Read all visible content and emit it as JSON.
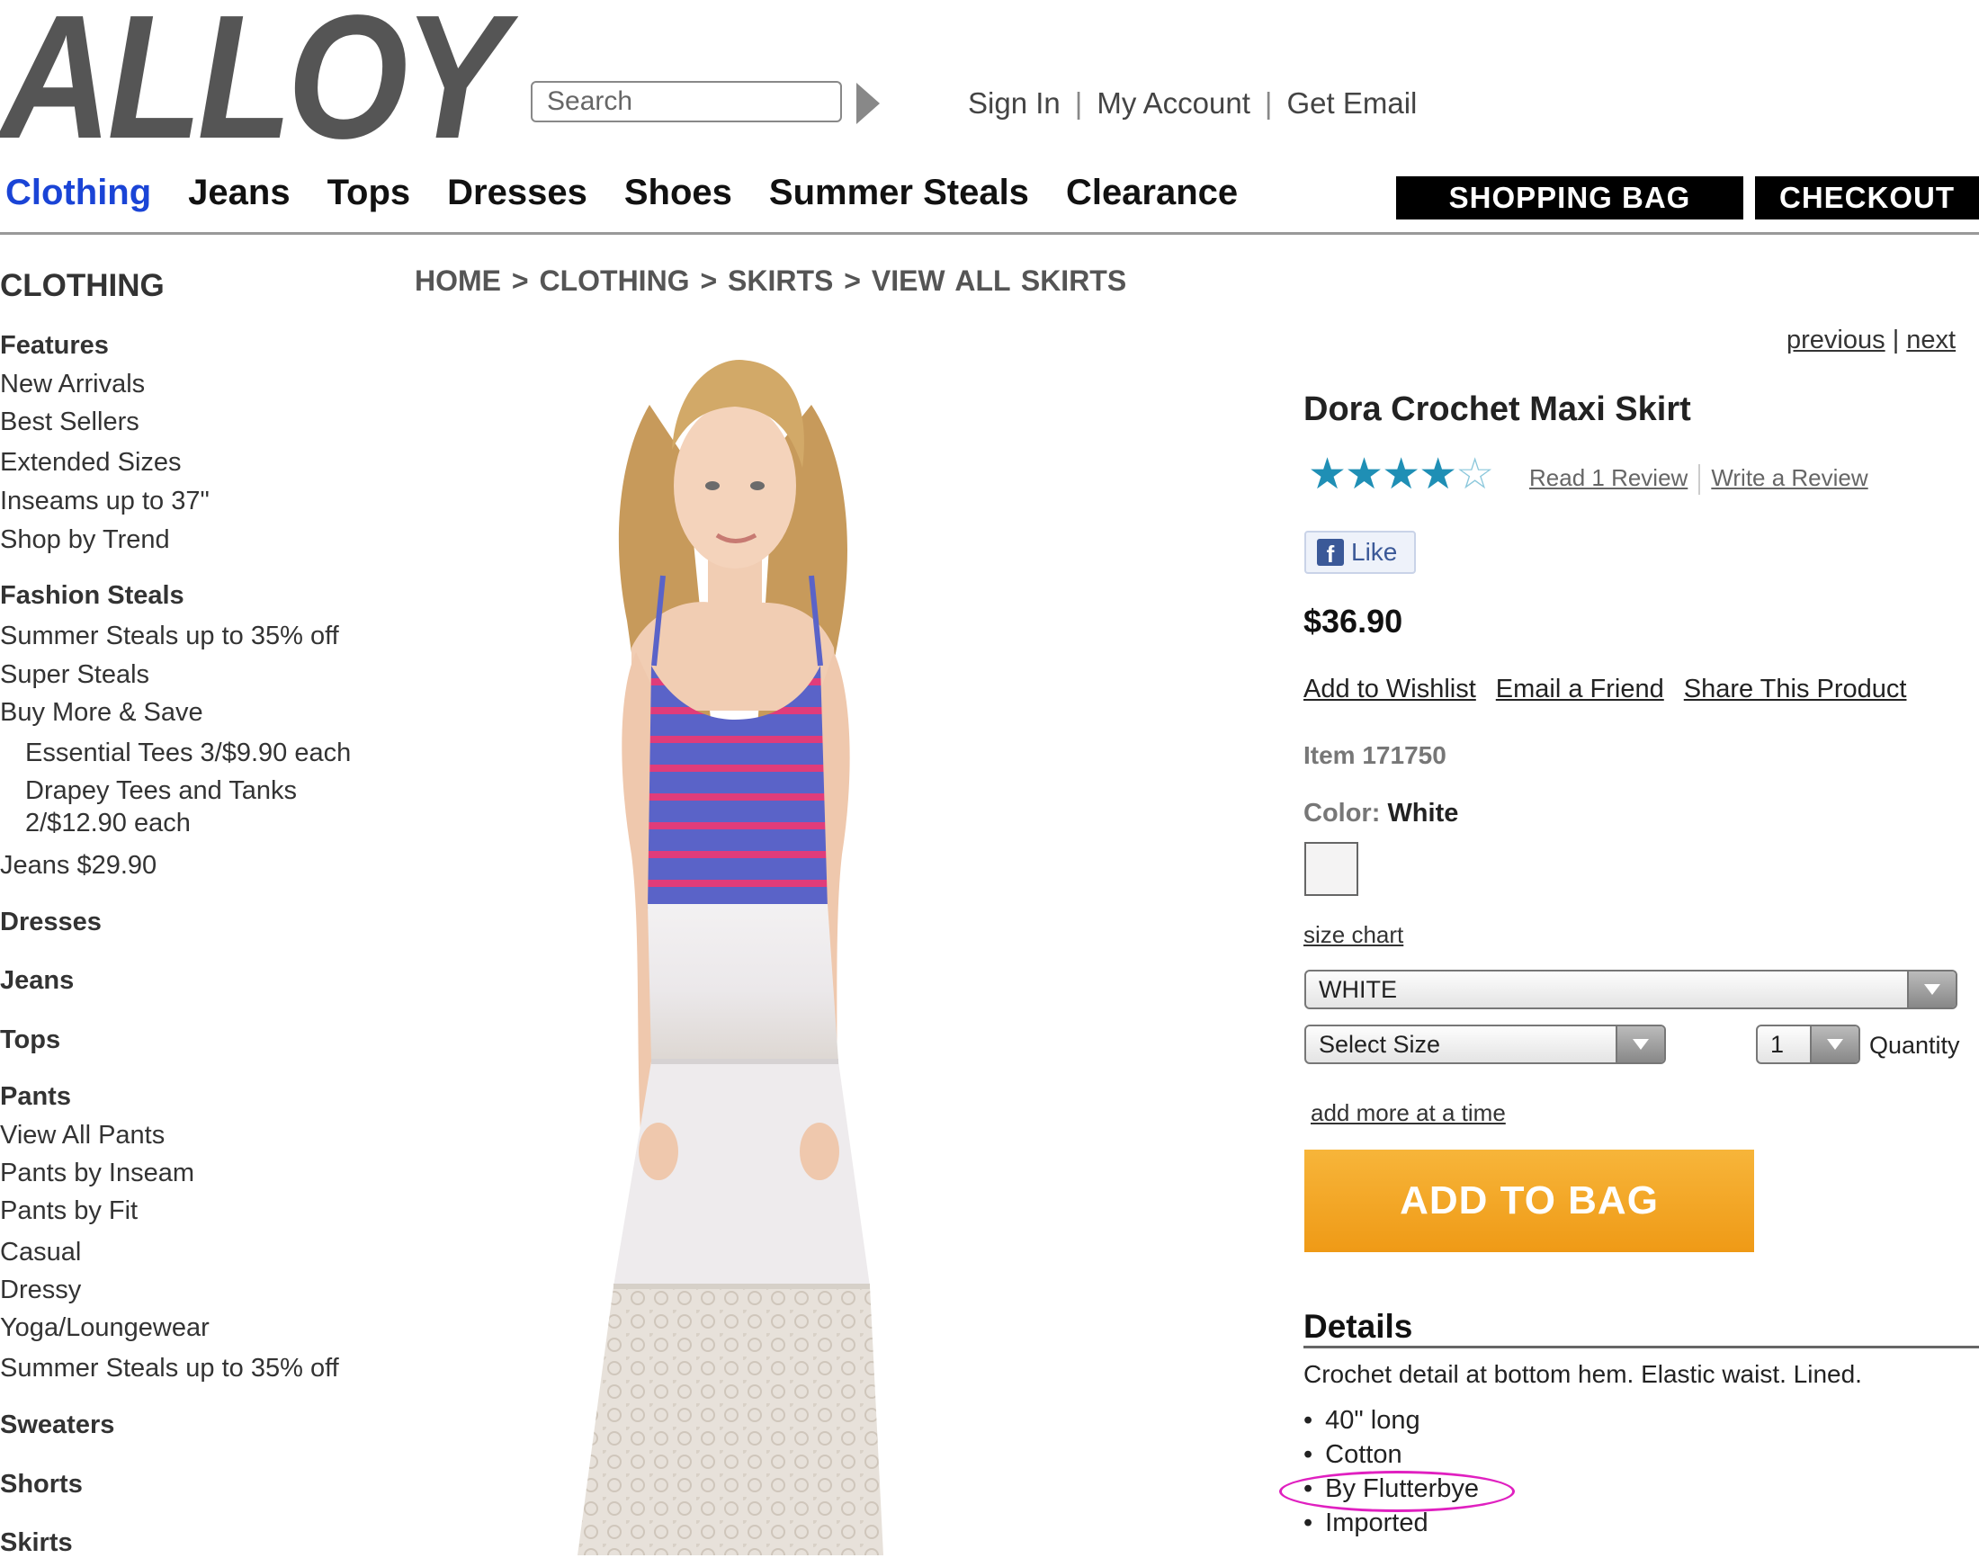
{
  "header": {
    "logo": "ALLOY",
    "search_placeholder": "Search",
    "sign_in": "Sign In",
    "my_account": "My Account",
    "get_email": "Get Email",
    "separator": "|"
  },
  "nav": {
    "items": [
      "Clothing",
      "Jeans",
      "Tops",
      "Dresses",
      "Shoes",
      "Summer Steals",
      "Clearance"
    ],
    "active": "Clothing",
    "shopping_bag": "SHOPPING BAG",
    "checkout": "CHECKOUT"
  },
  "sidebar": {
    "title": "CLOTHING",
    "items": [
      {
        "label": "Features",
        "heading": true
      },
      {
        "label": "New Arrivals"
      },
      {
        "label": "Best Sellers"
      },
      {
        "label": "Extended Sizes"
      },
      {
        "label": "Inseams up to 37\""
      },
      {
        "label": "Shop by Trend"
      },
      {
        "label": "Fashion Steals",
        "heading": true
      },
      {
        "label": "Summer Steals up to 35% off"
      },
      {
        "label": "Super Steals"
      },
      {
        "label": "Buy More & Save"
      },
      {
        "label": "Essential Tees 3/$9.90 each",
        "indent": true
      },
      {
        "label": "Drapey Tees and Tanks",
        "indent": true
      },
      {
        "label": "2/$12.90 each",
        "indent": true
      },
      {
        "label": "Jeans $29.90"
      },
      {
        "label": "Dresses",
        "heading": true
      },
      {
        "label": "Jeans",
        "heading": true
      },
      {
        "label": "Tops",
        "heading": true
      },
      {
        "label": "Pants",
        "heading": true
      },
      {
        "label": "View All Pants"
      },
      {
        "label": "Pants by Inseam"
      },
      {
        "label": "Pants by Fit"
      },
      {
        "label": "Casual"
      },
      {
        "label": "Dressy"
      },
      {
        "label": "Yoga/Loungewear"
      },
      {
        "label": "Summer Steals up to 35% off"
      },
      {
        "label": "Sweaters",
        "heading": true
      },
      {
        "label": "Shorts",
        "heading": true
      },
      {
        "label": "Skirts",
        "heading": true
      }
    ]
  },
  "breadcrumb": "HOME  >  CLOTHING  >  SKIRTS  >  VIEW ALL SKIRTS",
  "pager": {
    "previous": "previous",
    "next": "next",
    "separator": "|"
  },
  "product": {
    "title": "Dora Crochet Maxi Skirt",
    "rating": 4,
    "rating_max": 5,
    "read_reviews": "Read 1 Review",
    "write_review": "Write a Review",
    "like": "Like",
    "price": "$36.90",
    "add_to_wishlist": "Add to Wishlist",
    "email_friend": "Email a Friend",
    "share": "Share This Product",
    "item_number": "Item 171750",
    "color_label": "Color:",
    "color_value": "White",
    "size_chart": "size chart",
    "color_select": "WHITE",
    "size_select": "Select Size",
    "quantity_value": "1",
    "quantity_label": "Quantity",
    "add_more": "add more at a time",
    "add_to_bag": "ADD TO BAG",
    "details_heading": "Details",
    "details_text": "Crochet detail at bottom hem. Elastic waist. Lined.",
    "details_bullets": [
      "40\" long",
      "Cotton",
      "By Flutterbye",
      "Imported"
    ],
    "highlighted_bullet": "By Flutterbye"
  },
  "colors": {
    "nav_active": "#1a44d6",
    "add_to_bag": "#f2a324",
    "star": "#1f8fb5",
    "highlight_circle": "#e020c0",
    "top_stripe_blue": "#5a63c8",
    "top_stripe_pink": "#e03c7a"
  }
}
